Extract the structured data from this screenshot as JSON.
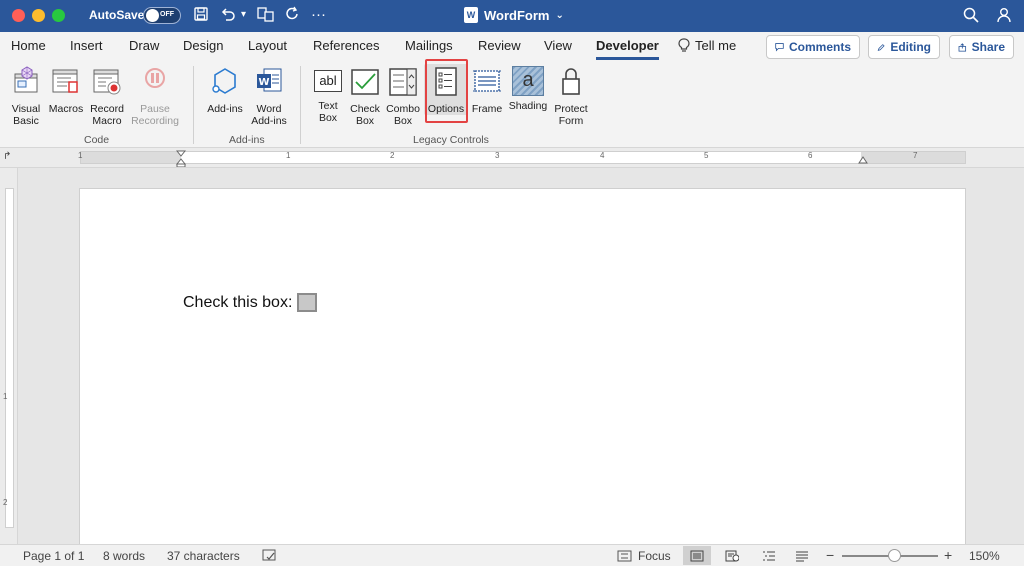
{
  "titlebar": {
    "autosave_label": "AutoSave",
    "autosave_state": "OFF",
    "doc_title": "WordForm",
    "doc_icon_letter": "W"
  },
  "tabs": [
    {
      "label": "Home"
    },
    {
      "label": "Insert"
    },
    {
      "label": "Draw"
    },
    {
      "label": "Design"
    },
    {
      "label": "Layout"
    },
    {
      "label": "References"
    },
    {
      "label": "Mailings"
    },
    {
      "label": "Review"
    },
    {
      "label": "View"
    },
    {
      "label": "Developer"
    },
    {
      "label": "Tell me"
    }
  ],
  "right_buttons": {
    "comments": "Comments",
    "editing": "Editing",
    "share": "Share"
  },
  "ribbon": {
    "code": {
      "group_label": "Code",
      "visual_basic": "Visual Basic",
      "macros": "Macros",
      "record_macro": "Record Macro",
      "pause_recording": "Pause Recording"
    },
    "addins": {
      "group_label": "Add-ins",
      "addins": "Add-ins",
      "word_addins": "Word Add-ins"
    },
    "legacy": {
      "group_label": "Legacy Controls",
      "text_box": "Text Box",
      "check_box": "Check Box",
      "combo_box": "Combo Box",
      "options": "Options",
      "frame": "Frame",
      "shading": "Shading",
      "protect_form": "Protect Form",
      "text_box_glyph": "abl",
      "shading_glyph": "a"
    }
  },
  "ruler": {
    "numbers": [
      "1",
      "1",
      "2",
      "3",
      "4",
      "5",
      "6",
      "7"
    ]
  },
  "vruler": {
    "numbers": [
      "1",
      "2"
    ]
  },
  "document": {
    "text": "Check this box:"
  },
  "status": {
    "page": "Page 1 of 1",
    "words": "8 words",
    "characters": "37 characters",
    "focus": "Focus",
    "zoom": "150%"
  },
  "colors": {
    "titlebar": "#2b579a",
    "highlight": "#e34343"
  }
}
